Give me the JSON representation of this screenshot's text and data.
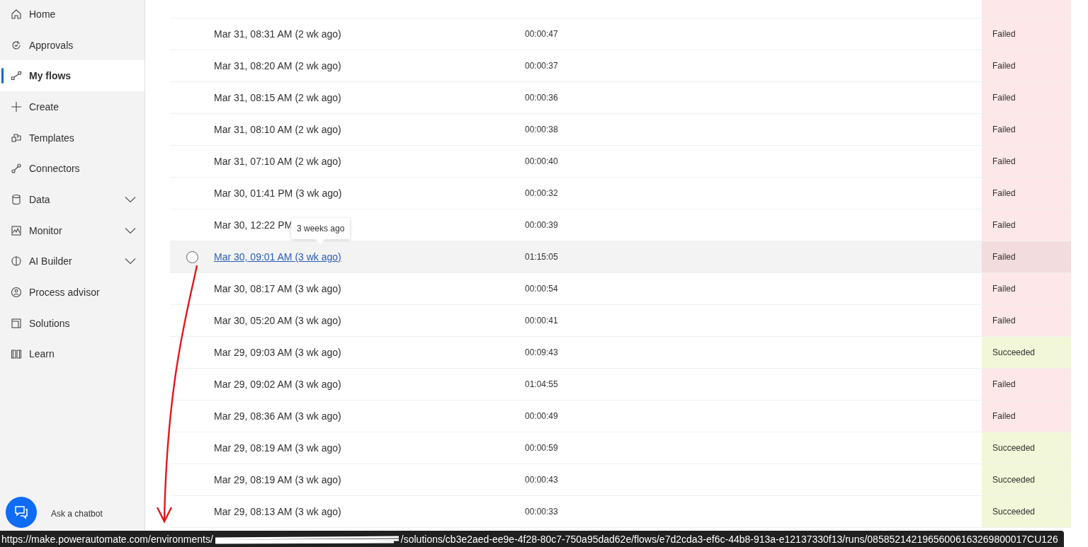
{
  "sidebar": {
    "items": [
      {
        "label": "Home",
        "selected": false
      },
      {
        "label": "Approvals",
        "selected": false
      },
      {
        "label": "My flows",
        "selected": true
      },
      {
        "label": "Create",
        "selected": false
      },
      {
        "label": "Templates",
        "selected": false
      },
      {
        "label": "Connectors",
        "selected": false
      },
      {
        "label": "Data",
        "selected": false,
        "expanded": false
      },
      {
        "label": "Monitor",
        "selected": false,
        "expanded": false
      },
      {
        "label": "AI Builder",
        "selected": false,
        "expanded": false
      },
      {
        "label": "Process advisor",
        "selected": false
      },
      {
        "label": "Solutions",
        "selected": false
      },
      {
        "label": "Learn",
        "selected": false
      }
    ],
    "chatbot": {
      "label": "Ask a chatbot"
    }
  },
  "runs": [
    {
      "start": "Mar 31, 08:31 AM (2 wk ago)",
      "duration": "00:00:47",
      "status": "Failed",
      "kind": "failed",
      "hovered": false
    },
    {
      "start": "Mar 31, 08:20 AM (2 wk ago)",
      "duration": "00:00:37",
      "status": "Failed",
      "kind": "failed",
      "hovered": false
    },
    {
      "start": "Mar 31, 08:15 AM (2 wk ago)",
      "duration": "00:00:36",
      "status": "Failed",
      "kind": "failed",
      "hovered": false
    },
    {
      "start": "Mar 31, 08:10 AM (2 wk ago)",
      "duration": "00:00:38",
      "status": "Failed",
      "kind": "failed",
      "hovered": false
    },
    {
      "start": "Mar 31, 07:10 AM (2 wk ago)",
      "duration": "00:00:40",
      "status": "Failed",
      "kind": "failed",
      "hovered": false
    },
    {
      "start": "Mar 30, 01:41 PM (3 wk ago)",
      "duration": "00:00:32",
      "status": "Failed",
      "kind": "failed",
      "hovered": false
    },
    {
      "start": "Mar 30, 12:22 PM",
      "duration": "00:00:39",
      "status": "Failed",
      "kind": "failed",
      "hovered": false
    },
    {
      "start": "Mar 30, 09:01 AM (3 wk ago)",
      "duration": "01:15:05",
      "status": "Failed",
      "kind": "failed",
      "hovered": true
    },
    {
      "start": "Mar 30, 08:17 AM (3 wk ago)",
      "duration": "00:00:54",
      "status": "Failed",
      "kind": "failed",
      "hovered": false
    },
    {
      "start": "Mar 30, 05:20 AM (3 wk ago)",
      "duration": "00:00:41",
      "status": "Failed",
      "kind": "failed",
      "hovered": false
    },
    {
      "start": "Mar 29, 09:03 AM (3 wk ago)",
      "duration": "00:09:43",
      "status": "Succeeded",
      "kind": "succeeded",
      "hovered": false
    },
    {
      "start": "Mar 29, 09:02 AM (3 wk ago)",
      "duration": "01:04:55",
      "status": "Failed",
      "kind": "failed",
      "hovered": false
    },
    {
      "start": "Mar 29, 08:36 AM (3 wk ago)",
      "duration": "00:00:49",
      "status": "Failed",
      "kind": "failed",
      "hovered": false
    },
    {
      "start": "Mar 29, 08:19 AM (3 wk ago)",
      "duration": "00:00:59",
      "status": "Succeeded",
      "kind": "succeeded",
      "hovered": false
    },
    {
      "start": "Mar 29, 08:19 AM (3 wk ago)",
      "duration": "00:00:43",
      "status": "Succeeded",
      "kind": "succeeded",
      "hovered": false
    },
    {
      "start": "Mar 29, 08:13 AM (3 wk ago)",
      "duration": "00:00:33",
      "status": "Succeeded",
      "kind": "succeeded",
      "hovered": false
    }
  ],
  "tooltip": {
    "text": "3 weeks ago"
  },
  "status_bar": {
    "url_start": "https://make.powerautomate.com/environments/",
    "url_end": "/solutions/cb3e2aed-ee9e-4f28-80c7-750a95dad62e/flows/e7d2cda3-ef6c-44b8-913a-e12137330f13/runs/08585214219656006163269800017CU126"
  }
}
